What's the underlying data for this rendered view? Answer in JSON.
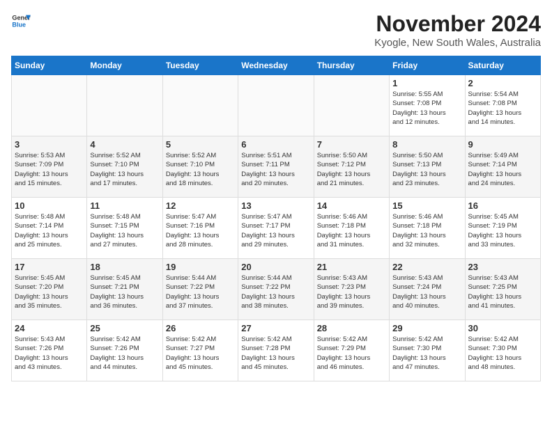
{
  "header": {
    "logo_line1": "General",
    "logo_line2": "Blue",
    "title": "November 2024",
    "subtitle": "Kyogle, New South Wales, Australia"
  },
  "days_of_week": [
    "Sunday",
    "Monday",
    "Tuesday",
    "Wednesday",
    "Thursday",
    "Friday",
    "Saturday"
  ],
  "weeks": [
    [
      {
        "day": "",
        "info": ""
      },
      {
        "day": "",
        "info": ""
      },
      {
        "day": "",
        "info": ""
      },
      {
        "day": "",
        "info": ""
      },
      {
        "day": "",
        "info": ""
      },
      {
        "day": "1",
        "info": "Sunrise: 5:55 AM\nSunset: 7:08 PM\nDaylight: 13 hours\nand 12 minutes."
      },
      {
        "day": "2",
        "info": "Sunrise: 5:54 AM\nSunset: 7:08 PM\nDaylight: 13 hours\nand 14 minutes."
      }
    ],
    [
      {
        "day": "3",
        "info": "Sunrise: 5:53 AM\nSunset: 7:09 PM\nDaylight: 13 hours\nand 15 minutes."
      },
      {
        "day": "4",
        "info": "Sunrise: 5:52 AM\nSunset: 7:10 PM\nDaylight: 13 hours\nand 17 minutes."
      },
      {
        "day": "5",
        "info": "Sunrise: 5:52 AM\nSunset: 7:10 PM\nDaylight: 13 hours\nand 18 minutes."
      },
      {
        "day": "6",
        "info": "Sunrise: 5:51 AM\nSunset: 7:11 PM\nDaylight: 13 hours\nand 20 minutes."
      },
      {
        "day": "7",
        "info": "Sunrise: 5:50 AM\nSunset: 7:12 PM\nDaylight: 13 hours\nand 21 minutes."
      },
      {
        "day": "8",
        "info": "Sunrise: 5:50 AM\nSunset: 7:13 PM\nDaylight: 13 hours\nand 23 minutes."
      },
      {
        "day": "9",
        "info": "Sunrise: 5:49 AM\nSunset: 7:14 PM\nDaylight: 13 hours\nand 24 minutes."
      }
    ],
    [
      {
        "day": "10",
        "info": "Sunrise: 5:48 AM\nSunset: 7:14 PM\nDaylight: 13 hours\nand 25 minutes."
      },
      {
        "day": "11",
        "info": "Sunrise: 5:48 AM\nSunset: 7:15 PM\nDaylight: 13 hours\nand 27 minutes."
      },
      {
        "day": "12",
        "info": "Sunrise: 5:47 AM\nSunset: 7:16 PM\nDaylight: 13 hours\nand 28 minutes."
      },
      {
        "day": "13",
        "info": "Sunrise: 5:47 AM\nSunset: 7:17 PM\nDaylight: 13 hours\nand 29 minutes."
      },
      {
        "day": "14",
        "info": "Sunrise: 5:46 AM\nSunset: 7:18 PM\nDaylight: 13 hours\nand 31 minutes."
      },
      {
        "day": "15",
        "info": "Sunrise: 5:46 AM\nSunset: 7:18 PM\nDaylight: 13 hours\nand 32 minutes."
      },
      {
        "day": "16",
        "info": "Sunrise: 5:45 AM\nSunset: 7:19 PM\nDaylight: 13 hours\nand 33 minutes."
      }
    ],
    [
      {
        "day": "17",
        "info": "Sunrise: 5:45 AM\nSunset: 7:20 PM\nDaylight: 13 hours\nand 35 minutes."
      },
      {
        "day": "18",
        "info": "Sunrise: 5:45 AM\nSunset: 7:21 PM\nDaylight: 13 hours\nand 36 minutes."
      },
      {
        "day": "19",
        "info": "Sunrise: 5:44 AM\nSunset: 7:22 PM\nDaylight: 13 hours\nand 37 minutes."
      },
      {
        "day": "20",
        "info": "Sunrise: 5:44 AM\nSunset: 7:22 PM\nDaylight: 13 hours\nand 38 minutes."
      },
      {
        "day": "21",
        "info": "Sunrise: 5:43 AM\nSunset: 7:23 PM\nDaylight: 13 hours\nand 39 minutes."
      },
      {
        "day": "22",
        "info": "Sunrise: 5:43 AM\nSunset: 7:24 PM\nDaylight: 13 hours\nand 40 minutes."
      },
      {
        "day": "23",
        "info": "Sunrise: 5:43 AM\nSunset: 7:25 PM\nDaylight: 13 hours\nand 41 minutes."
      }
    ],
    [
      {
        "day": "24",
        "info": "Sunrise: 5:43 AM\nSunset: 7:26 PM\nDaylight: 13 hours\nand 43 minutes."
      },
      {
        "day": "25",
        "info": "Sunrise: 5:42 AM\nSunset: 7:26 PM\nDaylight: 13 hours\nand 44 minutes."
      },
      {
        "day": "26",
        "info": "Sunrise: 5:42 AM\nSunset: 7:27 PM\nDaylight: 13 hours\nand 45 minutes."
      },
      {
        "day": "27",
        "info": "Sunrise: 5:42 AM\nSunset: 7:28 PM\nDaylight: 13 hours\nand 45 minutes."
      },
      {
        "day": "28",
        "info": "Sunrise: 5:42 AM\nSunset: 7:29 PM\nDaylight: 13 hours\nand 46 minutes."
      },
      {
        "day": "29",
        "info": "Sunrise: 5:42 AM\nSunset: 7:30 PM\nDaylight: 13 hours\nand 47 minutes."
      },
      {
        "day": "30",
        "info": "Sunrise: 5:42 AM\nSunset: 7:30 PM\nDaylight: 13 hours\nand 48 minutes."
      }
    ]
  ]
}
